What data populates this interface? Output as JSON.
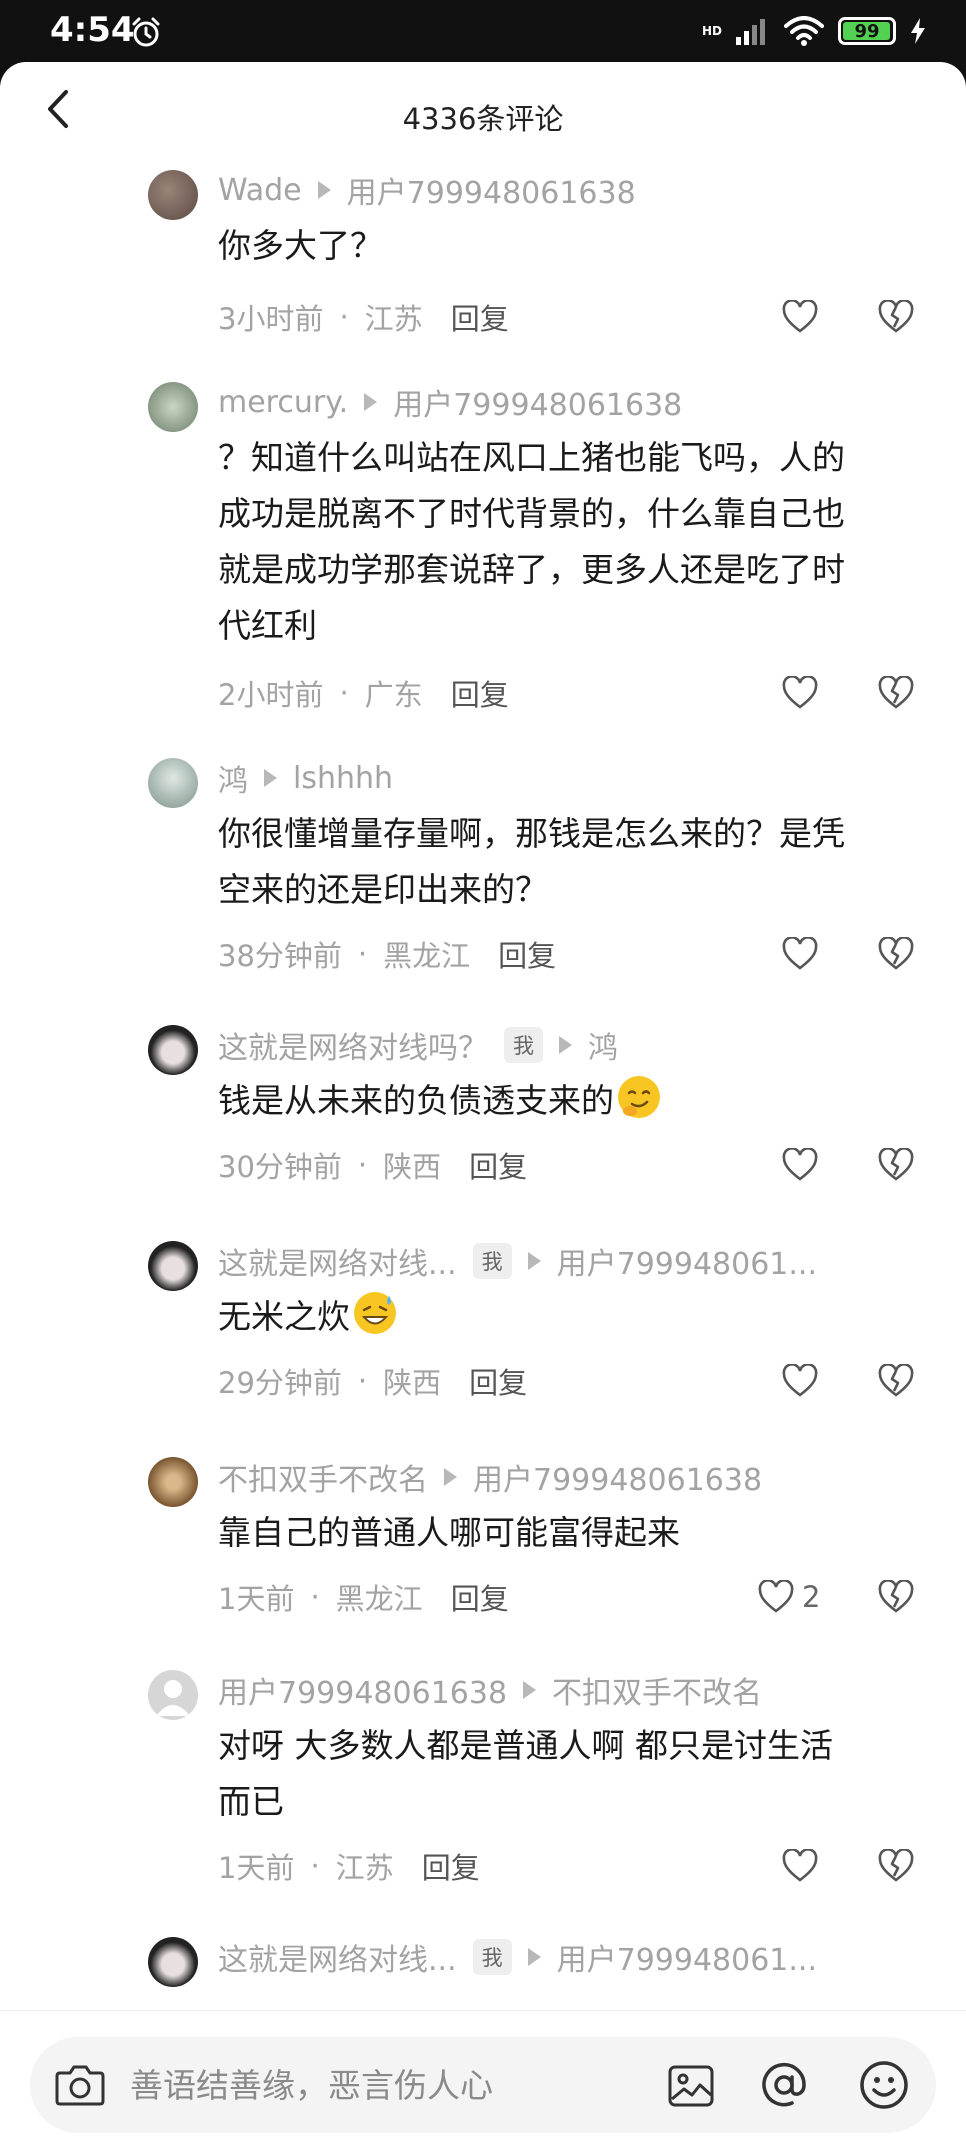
{
  "status_bar": {
    "time": "4:54",
    "network": "HD",
    "battery": "99"
  },
  "header": {
    "title": "4336条评论"
  },
  "comments": [
    {
      "author": "Wade",
      "reply_to": "用户799948061638",
      "is_me": false,
      "lines": [
        "你多大了？"
      ],
      "time": "3小时前",
      "location": "江苏",
      "reply_label": "回复",
      "likes": ""
    },
    {
      "author": "mercury.",
      "reply_to": "用户799948061638",
      "is_me": false,
      "lines": [
        "？知道什么叫站在风口上猪也能飞吗，人的",
        "成功是脱离不了时代背景的，什么靠自己也",
        "就是成功学那套说辞了，更多人还是吃了时",
        "代红利"
      ],
      "time": "2小时前",
      "location": "广东",
      "reply_label": "回复",
      "likes": ""
    },
    {
      "author": "鸿",
      "reply_to": "lshhhh",
      "is_me": false,
      "lines": [
        "你很懂增量存量啊，那钱是怎么来的？是凭",
        "空来的还是印出来的？"
      ],
      "time": "38分钟前",
      "location": "黑龙江",
      "reply_label": "回复",
      "likes": ""
    },
    {
      "author": "这就是网络对线吗？",
      "reply_to": "鸿",
      "is_me": true,
      "me_label": "我",
      "lines": [
        "钱是从未来的负债透支来的"
      ],
      "emoji": "smirk-emoji",
      "time": "30分钟前",
      "location": "陕西",
      "reply_label": "回复",
      "likes": ""
    },
    {
      "author": "这就是网络对线...",
      "reply_to": "用户799948061...",
      "is_me": true,
      "me_label": "我",
      "lines": [
        "无米之炊"
      ],
      "emoji": "sweat-smile-emoji",
      "time": "29分钟前",
      "location": "陕西",
      "reply_label": "回复",
      "likes": ""
    },
    {
      "author": "不扣双手不改名",
      "reply_to": "用户799948061638",
      "is_me": false,
      "lines": [
        "靠自己的普通人哪可能富得起来"
      ],
      "time": "1天前",
      "location": "黑龙江",
      "reply_label": "回复",
      "likes": "2"
    },
    {
      "author": "用户799948061638",
      "reply_to": "不扣双手不改名",
      "is_me": false,
      "lines": [
        "对呀 大多数人都是普通人啊 都只是讨生活",
        "而已"
      ],
      "time": "1天前",
      "location": "江苏",
      "reply_label": "回复",
      "likes": ""
    },
    {
      "author": "这就是网络对线...",
      "reply_to": "用户799948061...",
      "is_me": true,
      "me_label": "我",
      "lines": [],
      "time": "",
      "location": "",
      "reply_label": "",
      "likes": ""
    }
  ],
  "composer": {
    "placeholder": "善语结善缘，恶言伤人心"
  },
  "colors": {
    "accent_battery": "#52d152",
    "meta_gray": "#a3a3a3",
    "text": "#1a1a1a"
  }
}
